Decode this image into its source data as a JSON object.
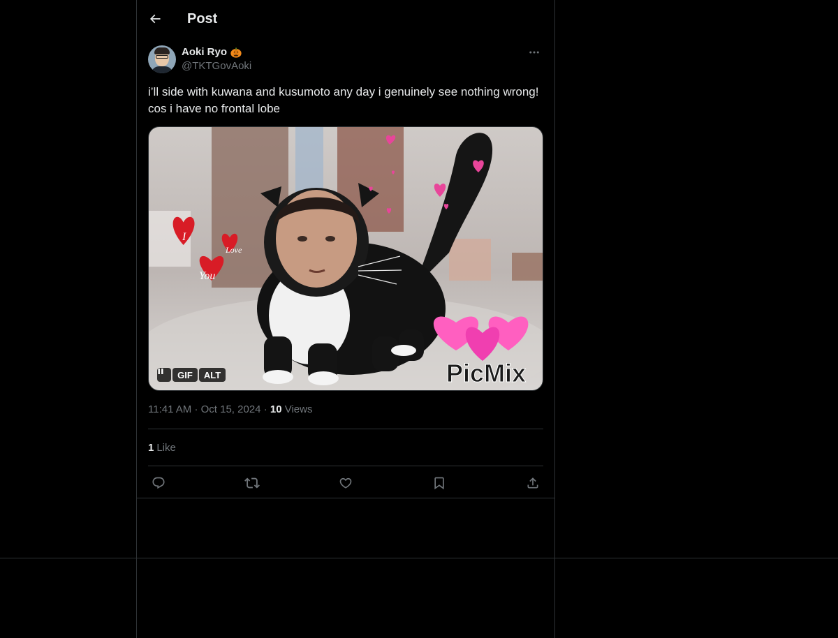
{
  "header": {
    "title": "Post"
  },
  "post": {
    "author": {
      "display_name": "Aoki Ryo",
      "handle": "@TKTGovAoki"
    },
    "text": "i’ll side with kuwana and kusumoto any day i genuinely see nothing wrong! cos i have no frontal lobe",
    "media": {
      "type": "gif",
      "overlay_text": "PicMix",
      "heart_text_1": "I",
      "heart_text_2": "Love",
      "heart_text_3": "You",
      "controls": {
        "gif_label": "GIF",
        "alt_label": "ALT"
      }
    },
    "meta": {
      "time": "11:41 AM",
      "date": "Oct 15, 2024",
      "views_count": "10",
      "views_label": "Views"
    },
    "likes": {
      "count": "1",
      "label": "Like"
    }
  },
  "colors": {
    "background": "#000000",
    "text": "#e7e9ea",
    "muted": "#71767b",
    "border": "#2f3336",
    "heart_pink": "#e8459a",
    "heart_red": "#d81c26"
  }
}
